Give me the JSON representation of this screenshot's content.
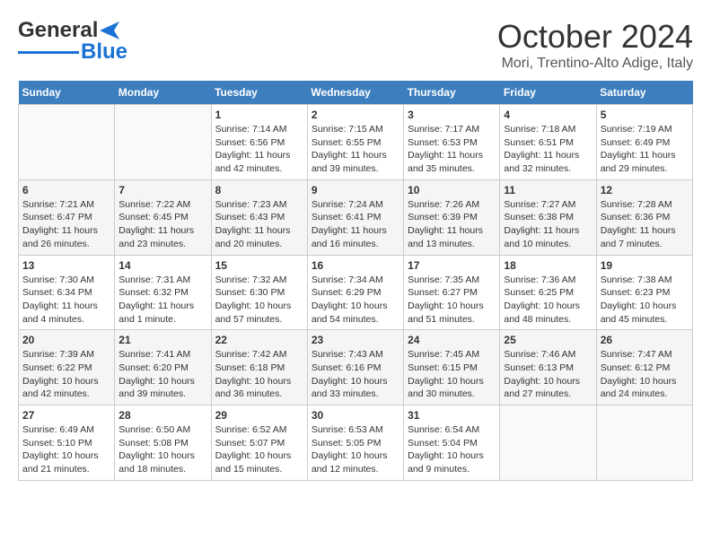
{
  "header": {
    "logo_line1": "General",
    "logo_line2": "Blue",
    "month": "October 2024",
    "location": "Mori, Trentino-Alto Adige, Italy"
  },
  "days_of_week": [
    "Sunday",
    "Monday",
    "Tuesday",
    "Wednesday",
    "Thursday",
    "Friday",
    "Saturday"
  ],
  "weeks": [
    [
      {
        "day": "",
        "empty": true
      },
      {
        "day": "",
        "empty": true
      },
      {
        "day": "1",
        "sunrise": "Sunrise: 7:14 AM",
        "sunset": "Sunset: 6:56 PM",
        "daylight": "Daylight: 11 hours and 42 minutes."
      },
      {
        "day": "2",
        "sunrise": "Sunrise: 7:15 AM",
        "sunset": "Sunset: 6:55 PM",
        "daylight": "Daylight: 11 hours and 39 minutes."
      },
      {
        "day": "3",
        "sunrise": "Sunrise: 7:17 AM",
        "sunset": "Sunset: 6:53 PM",
        "daylight": "Daylight: 11 hours and 35 minutes."
      },
      {
        "day": "4",
        "sunrise": "Sunrise: 7:18 AM",
        "sunset": "Sunset: 6:51 PM",
        "daylight": "Daylight: 11 hours and 32 minutes."
      },
      {
        "day": "5",
        "sunrise": "Sunrise: 7:19 AM",
        "sunset": "Sunset: 6:49 PM",
        "daylight": "Daylight: 11 hours and 29 minutes."
      }
    ],
    [
      {
        "day": "6",
        "sunrise": "Sunrise: 7:21 AM",
        "sunset": "Sunset: 6:47 PM",
        "daylight": "Daylight: 11 hours and 26 minutes."
      },
      {
        "day": "7",
        "sunrise": "Sunrise: 7:22 AM",
        "sunset": "Sunset: 6:45 PM",
        "daylight": "Daylight: 11 hours and 23 minutes."
      },
      {
        "day": "8",
        "sunrise": "Sunrise: 7:23 AM",
        "sunset": "Sunset: 6:43 PM",
        "daylight": "Daylight: 11 hours and 20 minutes."
      },
      {
        "day": "9",
        "sunrise": "Sunrise: 7:24 AM",
        "sunset": "Sunset: 6:41 PM",
        "daylight": "Daylight: 11 hours and 16 minutes."
      },
      {
        "day": "10",
        "sunrise": "Sunrise: 7:26 AM",
        "sunset": "Sunset: 6:39 PM",
        "daylight": "Daylight: 11 hours and 13 minutes."
      },
      {
        "day": "11",
        "sunrise": "Sunrise: 7:27 AM",
        "sunset": "Sunset: 6:38 PM",
        "daylight": "Daylight: 11 hours and 10 minutes."
      },
      {
        "day": "12",
        "sunrise": "Sunrise: 7:28 AM",
        "sunset": "Sunset: 6:36 PM",
        "daylight": "Daylight: 11 hours and 7 minutes."
      }
    ],
    [
      {
        "day": "13",
        "sunrise": "Sunrise: 7:30 AM",
        "sunset": "Sunset: 6:34 PM",
        "daylight": "Daylight: 11 hours and 4 minutes."
      },
      {
        "day": "14",
        "sunrise": "Sunrise: 7:31 AM",
        "sunset": "Sunset: 6:32 PM",
        "daylight": "Daylight: 11 hours and 1 minute."
      },
      {
        "day": "15",
        "sunrise": "Sunrise: 7:32 AM",
        "sunset": "Sunset: 6:30 PM",
        "daylight": "Daylight: 10 hours and 57 minutes."
      },
      {
        "day": "16",
        "sunrise": "Sunrise: 7:34 AM",
        "sunset": "Sunset: 6:29 PM",
        "daylight": "Daylight: 10 hours and 54 minutes."
      },
      {
        "day": "17",
        "sunrise": "Sunrise: 7:35 AM",
        "sunset": "Sunset: 6:27 PM",
        "daylight": "Daylight: 10 hours and 51 minutes."
      },
      {
        "day": "18",
        "sunrise": "Sunrise: 7:36 AM",
        "sunset": "Sunset: 6:25 PM",
        "daylight": "Daylight: 10 hours and 48 minutes."
      },
      {
        "day": "19",
        "sunrise": "Sunrise: 7:38 AM",
        "sunset": "Sunset: 6:23 PM",
        "daylight": "Daylight: 10 hours and 45 minutes."
      }
    ],
    [
      {
        "day": "20",
        "sunrise": "Sunrise: 7:39 AM",
        "sunset": "Sunset: 6:22 PM",
        "daylight": "Daylight: 10 hours and 42 minutes."
      },
      {
        "day": "21",
        "sunrise": "Sunrise: 7:41 AM",
        "sunset": "Sunset: 6:20 PM",
        "daylight": "Daylight: 10 hours and 39 minutes."
      },
      {
        "day": "22",
        "sunrise": "Sunrise: 7:42 AM",
        "sunset": "Sunset: 6:18 PM",
        "daylight": "Daylight: 10 hours and 36 minutes."
      },
      {
        "day": "23",
        "sunrise": "Sunrise: 7:43 AM",
        "sunset": "Sunset: 6:16 PM",
        "daylight": "Daylight: 10 hours and 33 minutes."
      },
      {
        "day": "24",
        "sunrise": "Sunrise: 7:45 AM",
        "sunset": "Sunset: 6:15 PM",
        "daylight": "Daylight: 10 hours and 30 minutes."
      },
      {
        "day": "25",
        "sunrise": "Sunrise: 7:46 AM",
        "sunset": "Sunset: 6:13 PM",
        "daylight": "Daylight: 10 hours and 27 minutes."
      },
      {
        "day": "26",
        "sunrise": "Sunrise: 7:47 AM",
        "sunset": "Sunset: 6:12 PM",
        "daylight": "Daylight: 10 hours and 24 minutes."
      }
    ],
    [
      {
        "day": "27",
        "sunrise": "Sunrise: 6:49 AM",
        "sunset": "Sunset: 5:10 PM",
        "daylight": "Daylight: 10 hours and 21 minutes."
      },
      {
        "day": "28",
        "sunrise": "Sunrise: 6:50 AM",
        "sunset": "Sunset: 5:08 PM",
        "daylight": "Daylight: 10 hours and 18 minutes."
      },
      {
        "day": "29",
        "sunrise": "Sunrise: 6:52 AM",
        "sunset": "Sunset: 5:07 PM",
        "daylight": "Daylight: 10 hours and 15 minutes."
      },
      {
        "day": "30",
        "sunrise": "Sunrise: 6:53 AM",
        "sunset": "Sunset: 5:05 PM",
        "daylight": "Daylight: 10 hours and 12 minutes."
      },
      {
        "day": "31",
        "sunrise": "Sunrise: 6:54 AM",
        "sunset": "Sunset: 5:04 PM",
        "daylight": "Daylight: 10 hours and 9 minutes."
      },
      {
        "day": "",
        "empty": true
      },
      {
        "day": "",
        "empty": true
      }
    ]
  ]
}
